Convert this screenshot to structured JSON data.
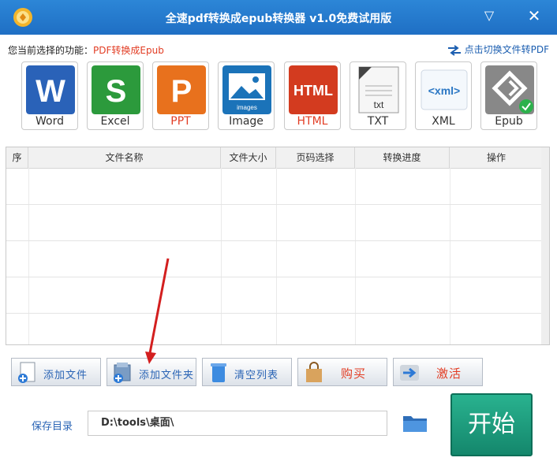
{
  "window": {
    "title": "全速pdf转换成epub转换器 v1.0免费试用版",
    "dropdown_icon": "▽",
    "close_icon": "✕"
  },
  "function_bar": {
    "label": "您当前选择的功能：",
    "value": "PDF转换成Epub",
    "switch_text": "点击切换文件转PDF"
  },
  "formats": [
    {
      "label": "Word",
      "icon": "word-icon",
      "color": "#2a62b8"
    },
    {
      "label": "Excel",
      "icon": "excel-icon",
      "color": "#2c9a3c"
    },
    {
      "label": "PPT",
      "icon": "ppt-icon",
      "color": "#e8711d"
    },
    {
      "label": "Image",
      "icon": "image-icon",
      "color": "#1b73b9"
    },
    {
      "label": "HTML",
      "icon": "html-icon",
      "color": "#d33b1f"
    },
    {
      "label": "TXT",
      "icon": "txt-icon",
      "color": "#666666"
    },
    {
      "label": "XML",
      "icon": "xml-icon",
      "color": "#2b77c4"
    },
    {
      "label": "Epub",
      "icon": "epub-icon",
      "color": "#888888"
    }
  ],
  "table": {
    "columns": [
      "序",
      "文件名称",
      "文件大小",
      "页码选择",
      "转换进度",
      "操作"
    ]
  },
  "actions": {
    "add_file": "添加文件",
    "add_folder": "添加文件夹",
    "clear_list": "清空列表",
    "buy": "购买",
    "activate": "激活"
  },
  "save": {
    "label": "保存目录",
    "path": "D:\\tools\\桌面\\"
  },
  "start": "开始"
}
